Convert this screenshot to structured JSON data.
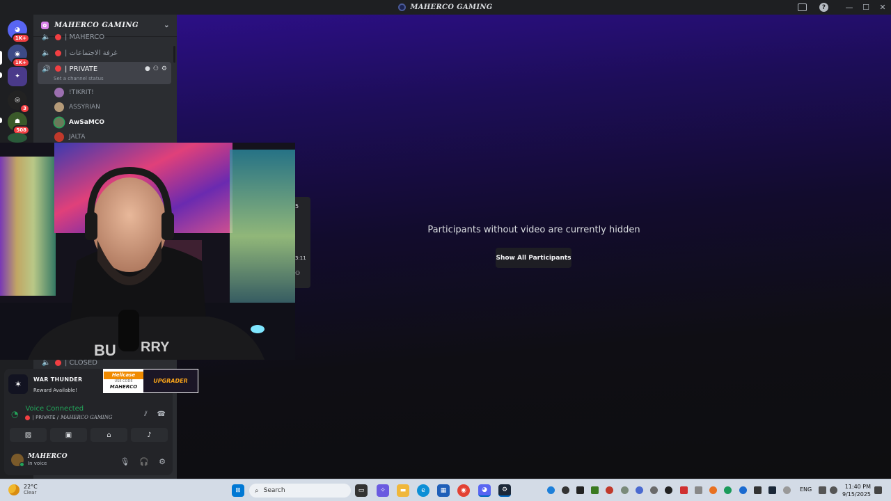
{
  "window": {
    "title": "MAHERCO GAMING",
    "controls": [
      "—",
      "☐",
      "✕"
    ]
  },
  "guild_badges": [
    "1K+",
    "1K+",
    "3",
    "508"
  ],
  "server": {
    "name": "MAHERCO GAMING",
    "channels": [
      {
        "name": "| MAHERCO"
      },
      {
        "name": "| غرفة الاجتماعات"
      },
      {
        "name": "| PRIVATE",
        "status": "Set a channel status"
      },
      {
        "name": "| CLOSED"
      }
    ],
    "members": [
      "!TIKRIT!",
      "ASSYRIAN",
      "AwSaMCO",
      "JALTA"
    ]
  },
  "popout": {
    "count": "5",
    "time": "3:11"
  },
  "main": {
    "hidden_message": "Participants without video are currently hidden",
    "show_button": "Show All Participants"
  },
  "promo": {
    "title": "WAR THUNDER",
    "subtitle": "Reward Available!"
  },
  "banner": {
    "brand": "Hellcase",
    "use_code": "USE CODE",
    "code": "MAHERCO",
    "cta": "UPGRADER"
  },
  "voice": {
    "status": "Voice Connected",
    "channel": "| PRIVATE /",
    "server": "MAHERCO GAMING"
  },
  "user": {
    "name": "MAHERCO",
    "status": "In voice"
  },
  "taskbar": {
    "temperature": "22°C",
    "condition": "Clear",
    "search_placeholder": "Search",
    "language": "ENG",
    "time": "11:40 PM",
    "date": "9/15/2025"
  },
  "colors": {
    "accent": "#5865f2",
    "danger": "#f23f42",
    "online": "#23a55a",
    "main_gradient_top": "#2c0f86"
  }
}
